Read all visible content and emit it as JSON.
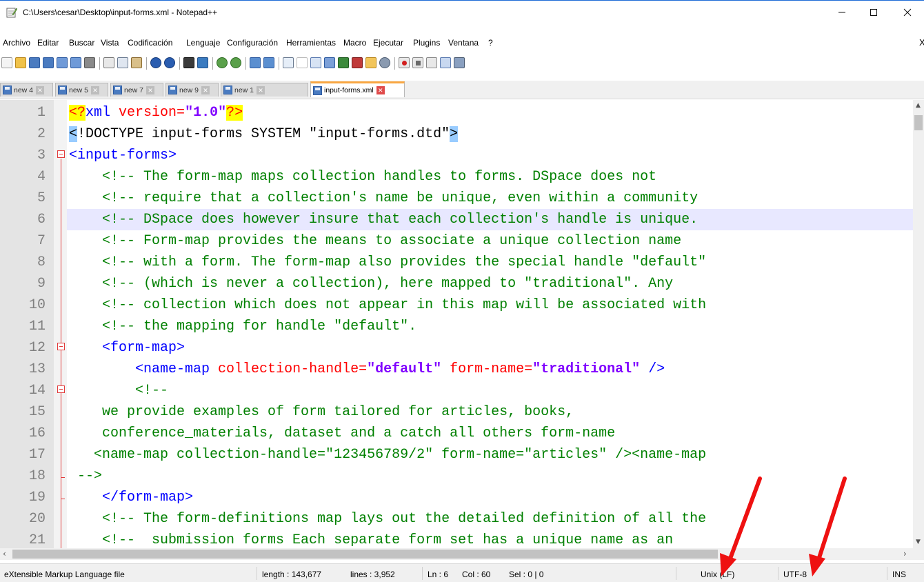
{
  "window": {
    "title": "C:\\Users\\cesar\\Desktop\\input-forms.xml - Notepad++",
    "minimize_glyph": "─",
    "maximize_glyph": "☐",
    "close_glyph": "✕"
  },
  "menu": {
    "items": [
      "Archivo",
      "Editar",
      "Buscar",
      "Vista",
      "Codificación",
      "Lenguaje",
      "Configuración",
      "Herramientas",
      "Macro",
      "Ejecutar",
      "Plugins",
      "Ventana",
      "?"
    ],
    "close_glyph": "X"
  },
  "toolbar": {
    "icons": [
      "new-file-icon",
      "open-file-icon",
      "save-icon",
      "save-all-icon",
      "close-icon",
      "close-all-icon",
      "print-icon",
      "cut-icon",
      "copy-icon",
      "paste-icon",
      "undo-icon",
      "redo-icon",
      "find-icon",
      "replace-icon",
      "zoom-in-icon",
      "zoom-out-icon",
      "sync-vertical-icon",
      "sync-horizontal-icon",
      "word-wrap-icon",
      "show-all-chars-icon",
      "indent-guide-icon",
      "udl-icon",
      "doc-map-icon",
      "function-list-icon",
      "folder-workspace-icon",
      "monitoring-icon",
      "record-macro-icon",
      "stop-macro-icon",
      "play-macro-icon",
      "run-macro-multiple-icon",
      "save-macro-icon"
    ]
  },
  "tabs": [
    {
      "label": "new 4",
      "active": false
    },
    {
      "label": "new 5",
      "active": false
    },
    {
      "label": "new 7",
      "active": false
    },
    {
      "label": "new 9",
      "active": false
    },
    {
      "label": "new 1",
      "active": false
    },
    {
      "label": "input-forms.xml",
      "active": true
    }
  ],
  "editor": {
    "current_line": 6,
    "lines": [
      {
        "n": "1"
      },
      {
        "n": "2"
      },
      {
        "n": "3"
      },
      {
        "n": "4"
      },
      {
        "n": "5"
      },
      {
        "n": "6"
      },
      {
        "n": "7"
      },
      {
        "n": "8"
      },
      {
        "n": "9"
      },
      {
        "n": "10"
      },
      {
        "n": "11"
      },
      {
        "n": "12"
      },
      {
        "n": "13"
      },
      {
        "n": "14"
      },
      {
        "n": "15"
      },
      {
        "n": "16"
      },
      {
        "n": "17"
      },
      {
        "n": "18"
      },
      {
        "n": "19"
      },
      {
        "n": "20"
      },
      {
        "n": "21"
      }
    ],
    "code": {
      "l1_a": "<?",
      "l1_b": "xml",
      "l1_c": " version=",
      "l1_d": "\"1.0\"",
      "l1_e": "?>",
      "l2_a": "<",
      "l2_b": "!DOCTYPE input-forms SYSTEM \"input-forms.dtd\"",
      "l2_c": ">",
      "l3": "<input-forms>",
      "l4": "    <!-- The form-map maps collection handles to forms. DSpace does not",
      "l5": "    <!-- require that a collection's name be unique, even within a community",
      "l6": "    <!-- DSpace does however insure that each collection's handle is unique.",
      "l7": "    <!-- Form-map provides the means to associate a unique collection name",
      "l8": "    <!-- with a form. The form-map also provides the special handle \"default\"",
      "l9": "    <!-- (which is never a collection), here mapped to \"traditional\". Any",
      "l10": "    <!-- collection which does not appear in this map will be associated with",
      "l11": "    <!-- the mapping for handle \"default\".",
      "l12": "    <form-map>",
      "l13_a": "        <name-map",
      "l13_b": " collection-handle=",
      "l13_c": "\"default\"",
      "l13_d": " form-name=",
      "l13_e": "\"traditional\"",
      "l13_f": " />",
      "l14": "        <!--",
      "l15": "    we provide examples of form tailored for articles, books,",
      "l16": "    conference_materials, dataset and a catch all others form-name",
      "l17": "   <name-map collection-handle=\"123456789/2\" form-name=\"articles\" /><name-map",
      "l18": " -->",
      "l19": "    </form-map>",
      "l20": "    <!-- The form-definitions map lays out the detailed definition of all the",
      "l21": "    <!--  submission forms Each separate form set has a unique name as an"
    }
  },
  "statusbar": {
    "file_type": "eXtensible Markup Language file",
    "length": "length : 143,677",
    "lines": "lines : 3,952",
    "ln": "Ln : 6",
    "col": "Col : 60",
    "sel": "Sel : 0 | 0",
    "eol": "Unix (LF)",
    "encoding": "UTF-8",
    "mode": "INS"
  },
  "colors": {
    "comment": "#008000",
    "tag": "#0000ff",
    "attribute": "#ff0000",
    "value": "#8000ff",
    "current_line": "#e8e8ff",
    "annotation_arrow": "#ee1111"
  }
}
